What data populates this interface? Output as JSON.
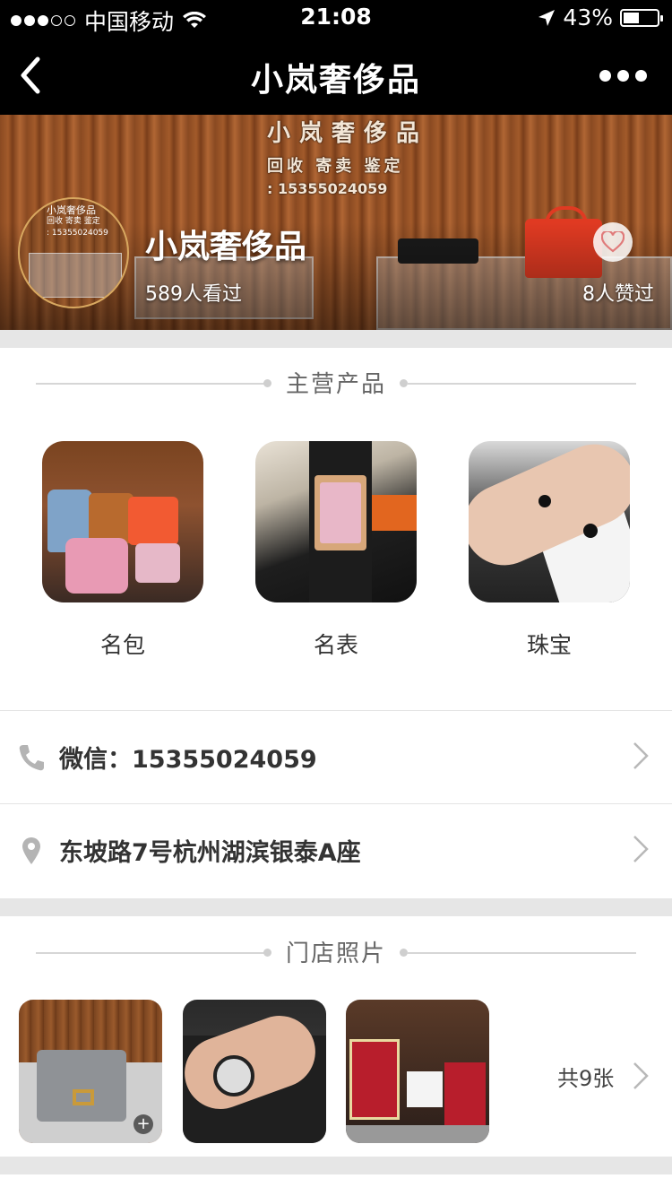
{
  "status_bar": {
    "carrier": "中国移动",
    "time": "21:08",
    "battery": "43%",
    "icons": [
      "signal-dots-icon",
      "wifi-icon",
      "location-arrow-icon",
      "battery-icon"
    ]
  },
  "nav": {
    "title": "小岚奢侈品",
    "icons": [
      "back-chevron-icon",
      "more-dots-icon"
    ]
  },
  "banner": {
    "sign_line1": "小岚奢侈品",
    "sign_line2": "回收 寄卖 鉴定",
    "sign_line3": ": 15355024059",
    "avatar_line1": "小岚奢侈品",
    "avatar_line2": "回收 寄卖 鉴定",
    "avatar_line3": ": 15355024059",
    "shop_name": "小岚奢侈品",
    "visits": "589人看过",
    "likes": "8人赞过"
  },
  "main_products": {
    "title": "主营产品",
    "items": [
      {
        "label": "名包"
      },
      {
        "label": "名表"
      },
      {
        "label": "珠宝"
      }
    ]
  },
  "contact": {
    "wechat": "微信：15355024059",
    "address": "东坡路7号杭州湖滨银泰A座"
  },
  "store_photos": {
    "title": "门店照片",
    "count": "共9张"
  },
  "colors": {
    "nav_bg": "#000000",
    "separator": "#e6e6e6",
    "icon_gray": "#b4b4b4",
    "like_heart": "#e07a7a"
  }
}
